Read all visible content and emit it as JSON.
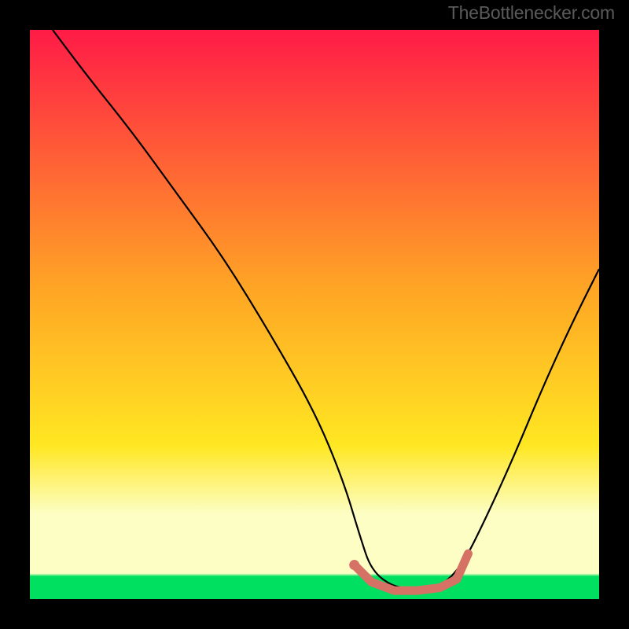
{
  "watermark": "TheBottlenecker.com",
  "colors": {
    "frame": "#000000",
    "curve": "#000000",
    "accent": "#d57165",
    "gradient_top": "#ff1b47",
    "gradient_mid": "#ffa425",
    "gradient_low": "#ffe722",
    "gradient_band": "#fcfec4",
    "gradient_green": "#00e060"
  },
  "chart_data": {
    "type": "line",
    "title": "",
    "subtitle": "",
    "xlabel": "",
    "ylabel": "",
    "xlim": [
      0,
      100
    ],
    "ylim": [
      0,
      100
    ],
    "grid": false,
    "legend": false,
    "series": [
      {
        "name": "bottleneck-curve",
        "x": [
          4,
          10,
          18,
          26,
          34,
          42,
          50,
          55,
          58,
          60,
          64,
          68,
          72,
          76,
          80,
          85,
          90,
          95,
          100
        ],
        "y": [
          100,
          92,
          82,
          71,
          60,
          47,
          33,
          21,
          11,
          5,
          2,
          2,
          2,
          6,
          14,
          25,
          37,
          48,
          58
        ]
      }
    ],
    "accent_segment": {
      "name": "optimal-zone",
      "x": [
        57,
        60,
        64,
        68,
        72,
        75,
        77
      ],
      "y": [
        6,
        3,
        1.5,
        1.5,
        2,
        3.5,
        8
      ]
    },
    "accent_dot": {
      "x": 57,
      "y": 6
    },
    "gradient_bands_y": {
      "band_start": 85,
      "green_start": 96
    }
  }
}
